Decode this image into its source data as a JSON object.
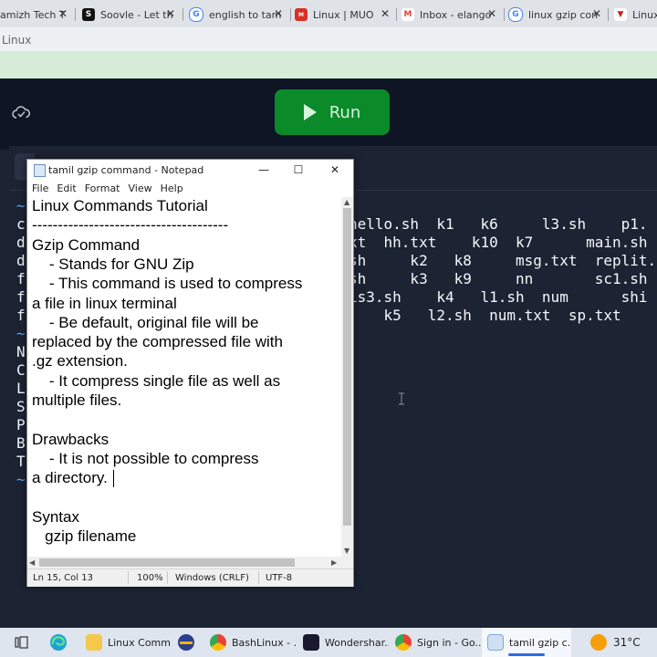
{
  "browser": {
    "tabs": [
      {
        "label": "amizh Tech T",
        "fav_color": "#d93025",
        "fav_glyph": ""
      },
      {
        "label": "Soovle - Let th",
        "fav_color": "#111111",
        "fav_glyph": "S"
      },
      {
        "label": "english to tam",
        "fav_color": "#4285f4",
        "fav_glyph": "G"
      },
      {
        "label": "Linux | MUO",
        "fav_color": "#d93025",
        "fav_glyph": "M"
      },
      {
        "label": "Inbox - elango",
        "fav_color": "#ea4335",
        "fav_glyph": "M"
      },
      {
        "label": "linux gzip con",
        "fav_color": "#4285f4",
        "fav_glyph": "G"
      },
      {
        "label": "Linux",
        "fav_color": "#c5221f",
        "fav_glyph": "▼"
      }
    ],
    "url_text": "Linux"
  },
  "replit": {
    "run_label": "Run"
  },
  "shell": {
    "left_lines": [
      "~",
      "c",
      "d",
      "d",
      "f",
      "f",
      "f",
      "~",
      "N",
      "C",
      "L",
      "S",
      "P",
      "B",
      "T",
      "~"
    ],
    "listing": [
      "hello.sh  k1   k6     l3.sh    p1.",
      "xt  hh.txt    k10  k7      main.sh",
      "sh     k2   k8     msg.txt  replit.",
      "sh     k3   k9     nn       sc1.sh",
      "is3.sh    k4   l1.sh  num      shi",
      "    k5   l2.sh  num.txt  sp.txt"
    ]
  },
  "notepad": {
    "title": "tamil gzip command - Notepad",
    "controls": {
      "minimize": "—",
      "maximize": "☐",
      "close": "✕"
    },
    "menu": [
      "File",
      "Edit",
      "Format",
      "View",
      "Help"
    ],
    "lines": [
      "Linux Commands Tutorial",
      "--------------------------------------",
      "Gzip Command",
      "    - Stands for GNU Zip",
      "    - This command is used to compress",
      "a file in linux terminal",
      "    - Be default, original file will be",
      "replaced by the compressed file with",
      ".gz extension.",
      "    - It compress single file as well as",
      "multiple files.",
      "",
      "Drawbacks",
      "    - It is not possible to compress",
      "a directory.",
      "",
      "Syntax",
      "   gzip filename"
    ],
    "status": {
      "position": "Ln 15, Col 13",
      "zoom": "100%",
      "line_ending": "Windows (CRLF)",
      "encoding": "UTF-8"
    }
  },
  "taskbar": {
    "items": [
      {
        "label": "Linux Comm...",
        "icon_color": "#f2c94c"
      },
      {
        "label": "BashLinux - ...",
        "icon_color": "#4285f4"
      },
      {
        "label": "Wondershar...",
        "icon_color": "#1a1a2e"
      },
      {
        "label": "Sign in - Go...",
        "icon_color": "#34a853"
      },
      {
        "label": "tamil gzip c...",
        "icon_color": "#7fa7d8"
      }
    ],
    "weather": "31°C"
  }
}
